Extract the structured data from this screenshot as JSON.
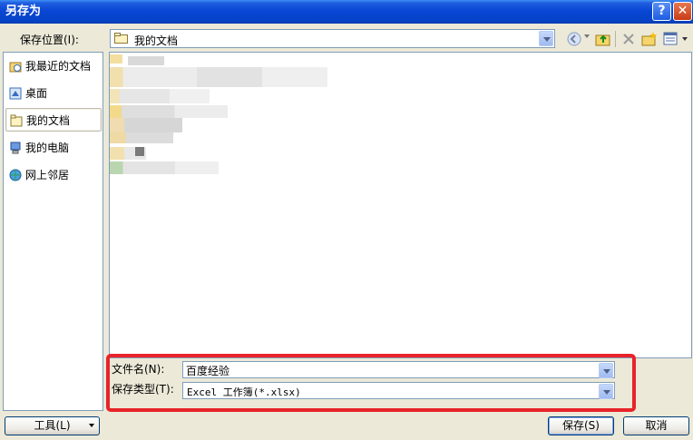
{
  "window": {
    "title": "另存为"
  },
  "location": {
    "label": "保存位置(I):",
    "value": "我的文档"
  },
  "places": [
    {
      "label": "我最近的文档",
      "icon": "recent-documents-icon"
    },
    {
      "label": "桌面",
      "icon": "desktop-icon"
    },
    {
      "label": "我的文档",
      "icon": "my-documents-icon",
      "selected": true
    },
    {
      "label": "我的电脑",
      "icon": "my-computer-icon"
    },
    {
      "label": "网上邻居",
      "icon": "network-places-icon"
    }
  ],
  "filename": {
    "label": "文件名(N):",
    "value": "百度经验"
  },
  "filetype": {
    "label": "保存类型(T):",
    "value": "Excel 工作簿(*.xlsx)"
  },
  "buttons": {
    "tools": "工具(L)",
    "save": "保存(S)",
    "cancel": "取消"
  },
  "colors": {
    "title_bar": "#0a46d4",
    "highlight": "#e8232a",
    "dialog_bg": "#ece9d8"
  }
}
